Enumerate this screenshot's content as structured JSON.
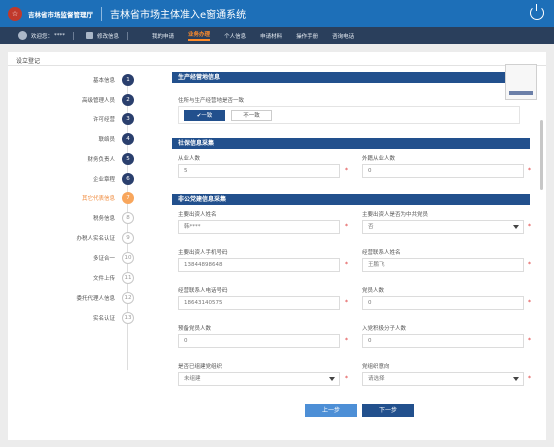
{
  "header": {
    "org_name": "吉林省市场监督管理厅",
    "system_title": "吉林省市场主体准入e窗通系统",
    "logo_glyph": "☆"
  },
  "nav": {
    "welcome": "欢迎您：",
    "username_masked": "****",
    "change_info": "修改信息",
    "items": [
      "我的申请",
      "业务办理",
      "个人信息",
      "申请材料",
      "操作手册",
      "咨询电话"
    ],
    "active_index": 1
  },
  "breadcrumb": "设立登记",
  "steps": [
    {
      "label": "基本信息",
      "num": "1",
      "state": "done"
    },
    {
      "label": "高级管理人员",
      "num": "2",
      "state": "done"
    },
    {
      "label": "许可经营",
      "num": "3",
      "state": "done"
    },
    {
      "label": "联络员",
      "num": "4",
      "state": "done"
    },
    {
      "label": "财务负责人",
      "num": "5",
      "state": "done"
    },
    {
      "label": "企业章程",
      "num": "6",
      "state": "done"
    },
    {
      "label": "其它代表信息",
      "num": "7",
      "state": "current"
    },
    {
      "label": "税务信息",
      "num": "8",
      "state": "pending"
    },
    {
      "label": "办税人实名认证",
      "num": "9",
      "state": "pending"
    },
    {
      "label": "多证合一",
      "num": "10",
      "state": "pending"
    },
    {
      "label": "文件上传",
      "num": "11",
      "state": "pending"
    },
    {
      "label": "委托代理人信息",
      "num": "12",
      "state": "pending"
    },
    {
      "label": "实名认证",
      "num": "13",
      "state": "pending"
    }
  ],
  "production": {
    "title": "生产经营地信息",
    "question": "住所与生产经营地是否一致",
    "yes": "✔一致",
    "no": "不一致"
  },
  "social": {
    "title": "社保信息采集",
    "employees_label": "从业人数",
    "employees_value": "5",
    "foreign_label": "外籍从业人数",
    "foreign_value": "0"
  },
  "party": {
    "title": "非公党建信息采集",
    "investor_name_label": "主要出资人姓名",
    "investor_name_value": "韩****",
    "investor_member_label": "主要出资人是否为中共党员",
    "investor_member_value": "否",
    "investor_phone_label": "主要出资人手机号码",
    "investor_phone_value": "13844898648",
    "contact_name_label": "经营联系人姓名",
    "contact_name_value": "王鹏飞",
    "contact_phone_label": "经营联系人电话号码",
    "contact_phone_value": "18643140575",
    "party_count_label": "党员人数",
    "party_count_value": "0",
    "probation_label": "预备党员人数",
    "probation_value": "0",
    "applicant_label": "入党积极分子人数",
    "applicant_value": "0",
    "org_built_label": "是否已组建党组织",
    "org_built_value": "未组建",
    "org_intent_label": "党组织意向",
    "org_intent_value": "请选择"
  },
  "buttons": {
    "prev": "上一步",
    "next": "下一步"
  },
  "colors": {
    "header_blue": "#1d6fb8",
    "nav_dark": "#2a3f5c",
    "section_navy": "#22508d",
    "accent_orange": "#f08a3c"
  }
}
